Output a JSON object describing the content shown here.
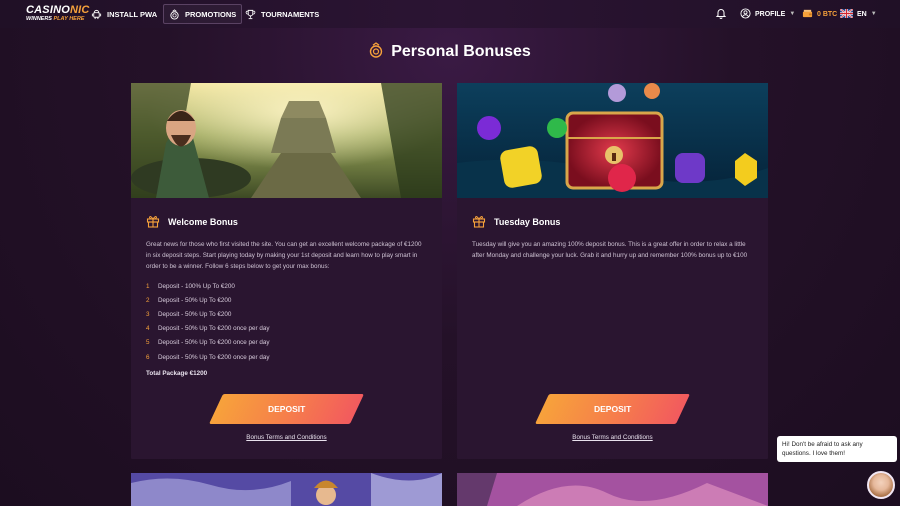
{
  "brand": {
    "logo_main": "CASINO",
    "logo_accent": "NIC",
    "tagline_main": "WINNERS ",
    "tagline_accent": "PLAY HERE"
  },
  "nav": {
    "items": [
      {
        "label": "INSTALL PWA",
        "icon": "android-icon"
      },
      {
        "label": "PROMOTIONS",
        "icon": "bonus-coin-icon",
        "active": true
      },
      {
        "label": "TOURNAMENTS",
        "icon": "trophy-icon"
      }
    ]
  },
  "header_right": {
    "profile_label": "PROFILE",
    "balance": "0 BTC",
    "language": "EN"
  },
  "page": {
    "title": "Personal Bonuses"
  },
  "cards": [
    {
      "title": "Welcome Bonus",
      "description": "Great news for those who first visited the site. You can get an excellent welcome package of €1200 in six deposit steps. Start playing today by making your 1st deposit and learn how to play smart in order to be a winner. Follow 6 steps below to get your max bonus:",
      "steps": [
        {
          "num": "1",
          "text": "Deposit - 100% Up To €200"
        },
        {
          "num": "2",
          "text": "Deposit - 50% Up To €200"
        },
        {
          "num": "3",
          "text": "Deposit - 50% Up To €200"
        },
        {
          "num": "4",
          "text": "Deposit - 50% Up To €200 once per day"
        },
        {
          "num": "5",
          "text": "Deposit - 50% Up To €200 once per day"
        },
        {
          "num": "6",
          "text": "Deposit - 50% Up To €200 once per day"
        }
      ],
      "total": "Total Package €1200",
      "button": "DEPOSIT",
      "terms": "Bonus Terms and Conditions"
    },
    {
      "title": "Tuesday Bonus",
      "description": "Tuesday will give you an amazing 100% deposit bonus. This is a great offer in order to relax a little after Monday and challenge your luck. Grab it and hurry up and remember 100% bonus up to €100",
      "button": "DEPOSIT",
      "terms": "Bonus Terms and Conditions"
    }
  ],
  "chat": {
    "message": "Hi! Don't be afraid to ask any questions. I love them!"
  },
  "colors": {
    "accent": "#f7a23b",
    "button_end": "#f25a5e",
    "card_bg": "#2a1530",
    "page_bg": "#241128"
  }
}
